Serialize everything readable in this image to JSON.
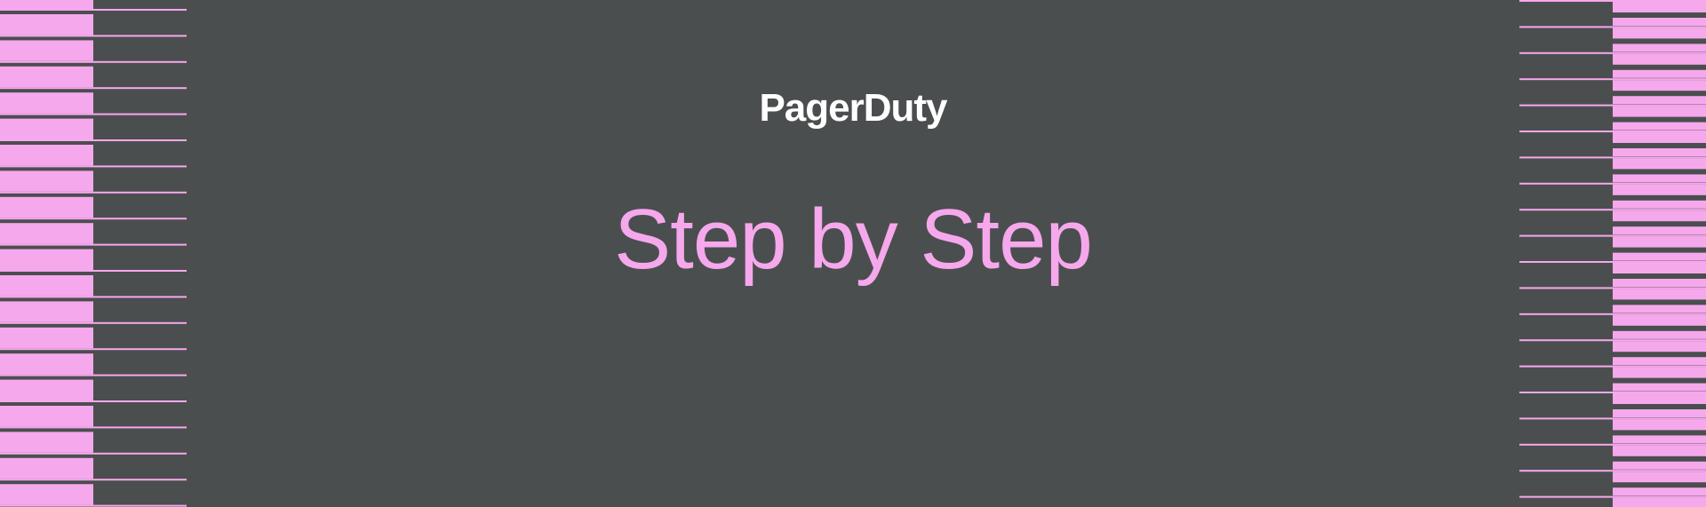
{
  "brand": {
    "logo_text": "PagerDuty"
  },
  "heading": {
    "title": "Step by Step"
  },
  "colors": {
    "background": "#4b4e4f",
    "accent_pink": "#f6a8ec",
    "logo_white": "#ffffff"
  }
}
